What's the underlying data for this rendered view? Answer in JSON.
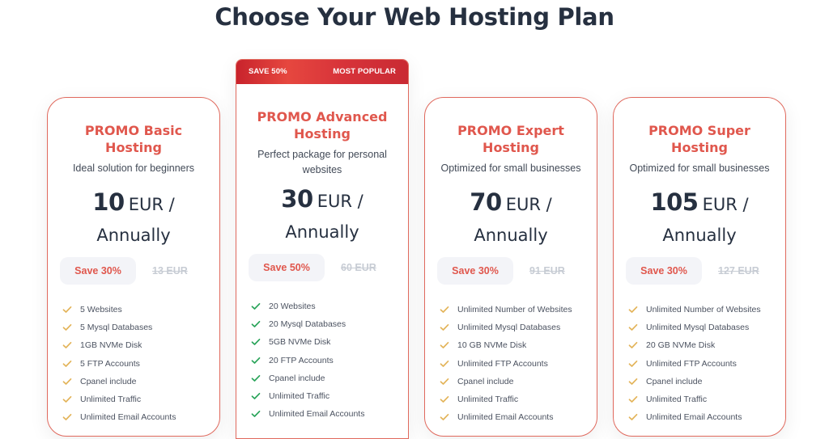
{
  "page": {
    "title": "Choose Your Web Hosting Plan"
  },
  "colors": {
    "accent": "#e0574d",
    "ribbon": "#d8343a",
    "check_gold": "#e3b45a",
    "check_green": "#2aa45a"
  },
  "plans": [
    {
      "name": "PROMO Basic Hosting",
      "description": "Ideal solution for beginners",
      "price": "10",
      "currency": "EUR /",
      "period": "Annually",
      "save_label": "Save 30%",
      "old_price": "13 EUR",
      "check_icon": "checkmark-icon",
      "features": [
        "5 Websites",
        "5 Mysql Databases",
        "1GB NVMe Disk",
        "5 FTP Accounts",
        "Cpanel include",
        "Unlimited Traffic",
        "Unlimited Email Accounts"
      ]
    },
    {
      "name": "PROMO Advanced Hosting",
      "description": "Perfect package for personal websites",
      "price": "30",
      "currency": "EUR /",
      "period": "Annually",
      "save_label": "Save 50%",
      "old_price": "60 EUR",
      "ribbon_left": "SAVE 50%",
      "ribbon_right": "MOST POPULAR",
      "check_icon": "checkmark-icon",
      "features": [
        "20 Websites",
        "20 Mysql Databases",
        "5GB NVMe Disk",
        "20 FTP Accounts",
        "Cpanel include",
        "Unlimited Traffic",
        "Unlimited Email Accounts"
      ]
    },
    {
      "name": "PROMO Expert Hosting",
      "description": "Optimized for small businesses",
      "price": "70",
      "currency": "EUR /",
      "period": "Annually",
      "save_label": "Save 30%",
      "old_price": "91 EUR",
      "check_icon": "checkmark-icon",
      "features": [
        "Unlimited Number of Websites",
        "Unlimited Mysql Databases",
        "10 GB NVMe Disk",
        "Unlimited FTP Accounts",
        "Cpanel include",
        "Unlimited Traffic",
        "Unlimited Email Accounts"
      ]
    },
    {
      "name": "PROMO Super Hosting",
      "description": "Optimized for small businesses",
      "price": "105",
      "currency": "EUR /",
      "period": "Annually",
      "save_label": "Save 30%",
      "old_price": "127 EUR",
      "check_icon": "checkmark-icon",
      "features": [
        "Unlimited Number of Websites",
        "Unlimited Mysql Databases",
        "20 GB NVMe Disk",
        "Unlimited FTP Accounts",
        "Cpanel include",
        "Unlimited Traffic",
        "Unlimited Email Accounts"
      ]
    }
  ]
}
